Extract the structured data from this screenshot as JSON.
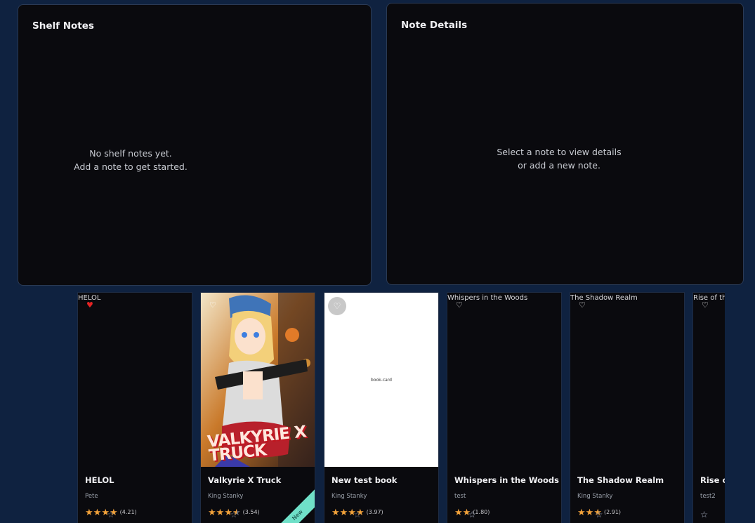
{
  "shelf_notes": {
    "title": "Shelf Notes",
    "empty_line1": "No shelf notes yet.",
    "empty_line2": "Add a note to get started."
  },
  "note_details": {
    "title": "Note Details",
    "empty_line1": "Select a note to view details",
    "empty_line2": "or add a new note."
  },
  "books": [
    {
      "cover_title": "HELOL",
      "title": "HELOL",
      "author": "Pete",
      "rating": "(4.21)",
      "stars": 4,
      "favorite": true
    },
    {
      "cover_title": "",
      "title": "Valkyrie X Truck",
      "author": "King Stanky",
      "rating": "(3.54)",
      "stars": 3.5,
      "favorite": false,
      "badge": "New",
      "cover_text": "VALKYRIE X TRUCK"
    },
    {
      "cover_title": "",
      "title": "New test book",
      "author": "King Stanky",
      "rating": "(3.97)",
      "stars": 4,
      "favorite": false,
      "cover_label": "book-card"
    },
    {
      "cover_title": "Whispers in the Woods",
      "title": "Whispers in the Woods",
      "author": "test",
      "rating": "(1.80)",
      "stars": 2,
      "favorite": false
    },
    {
      "cover_title": "The Shadow Realm",
      "title": "The Shadow Realm",
      "author": "King Stanky",
      "rating": "(2.91)",
      "stars": 3,
      "favorite": false
    },
    {
      "cover_title": "Rise of th",
      "title": "Rise of",
      "author": "test2",
      "rating": "",
      "stars": 0,
      "favorite": false
    }
  ],
  "colors": {
    "star": "#f2a23a",
    "favorite": "#e52424",
    "new_badge": "#6fe0c8"
  }
}
